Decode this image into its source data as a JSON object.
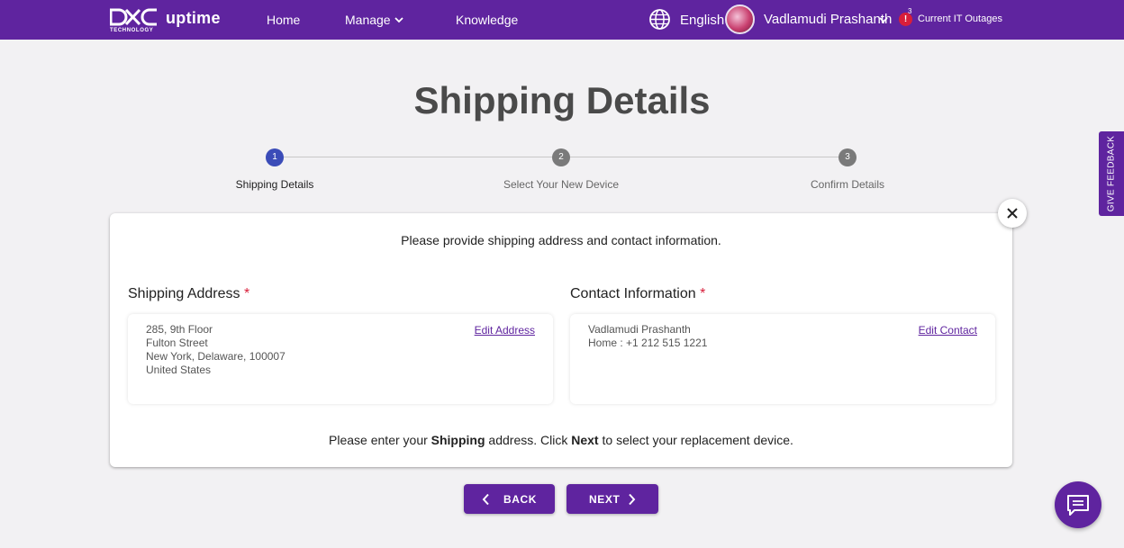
{
  "header": {
    "brand_sub": "TECHNOLOGY",
    "brand_name": "uptime",
    "nav": {
      "home": "Home",
      "manage": "Manage",
      "knowledge": "Knowledge"
    },
    "language": "English",
    "user_name": "Vadlamudi Prashanth",
    "alert_symbol": "!",
    "alert_count": "3",
    "outages_label": "Current IT Outages"
  },
  "page": {
    "title": "Shipping Details"
  },
  "stepper": {
    "steps": [
      {
        "number": "1",
        "label": "Shipping Details",
        "state": "active"
      },
      {
        "number": "2",
        "label": "Select Your New Device",
        "state": "inactive"
      },
      {
        "number": "3",
        "label": "Confirm Details",
        "state": "inactive"
      }
    ]
  },
  "card": {
    "intro": "Please provide shipping address and contact information.",
    "shipping": {
      "heading": "Shipping Address",
      "required_mark": "*",
      "lines": [
        "285, 9th Floor",
        "Fulton Street",
        "New York, Delaware, 100007",
        "United States"
      ],
      "edit_label": "Edit Address"
    },
    "contact": {
      "heading": "Contact Information",
      "required_mark": "*",
      "lines": [
        "Vadlamudi Prashanth",
        "Home : +1 212 515 1221"
      ],
      "edit_label": "Edit Contact"
    },
    "footer": {
      "part1": "Please enter your ",
      "bold1": "Shipping",
      "part2": " address. Click ",
      "bold2": "Next",
      "part3": " to select your replacement device."
    }
  },
  "actions": {
    "back_label": "BACK",
    "next_label": "NEXT"
  },
  "feedback_label": "GIVE FEEDBACK",
  "colors": {
    "brand": "#5f249f",
    "active_step": "#3b4cb8",
    "inactive_step": "#7a7a7a",
    "alert": "#d81e3a"
  },
  "icons": {
    "logo": "dxc-logo",
    "manage_chevron": "chevron-down-icon",
    "language": "globe-icon",
    "user_chevron": "chevron-down-icon",
    "alert": "alert-icon",
    "close": "close-icon",
    "back": "chevron-left-icon",
    "next": "chevron-right-icon",
    "chat": "chat-icon"
  }
}
